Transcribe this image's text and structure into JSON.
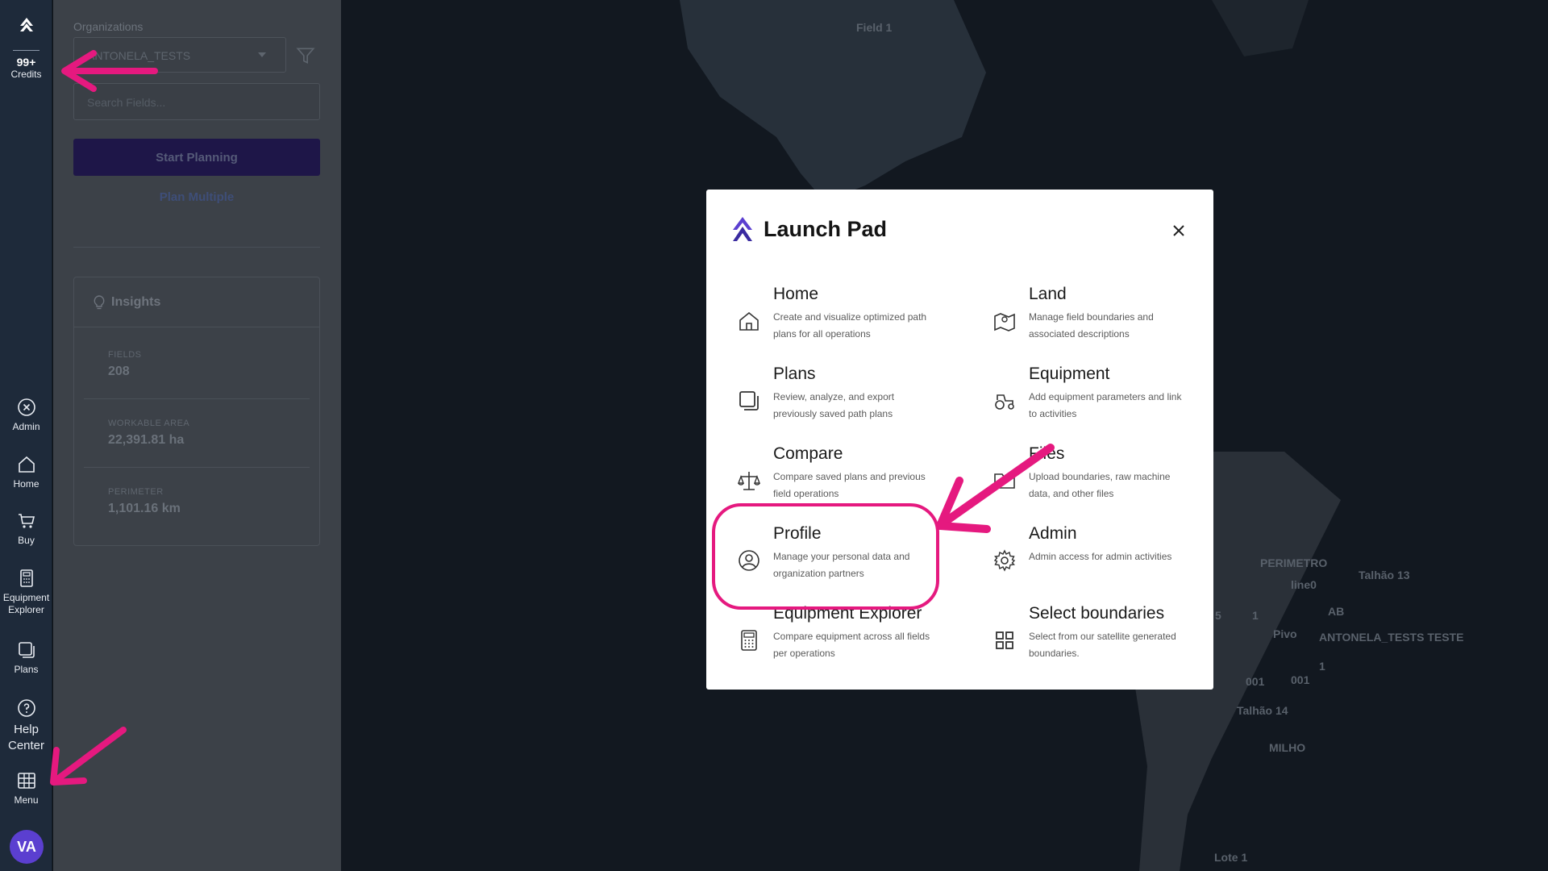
{
  "rail": {
    "credits_count": "99+",
    "credits_label": "Credits",
    "items": [
      {
        "label": "Admin"
      },
      {
        "label": "Home"
      },
      {
        "label": "Buy"
      },
      {
        "label": "Equipment Explorer"
      },
      {
        "label": "Plans"
      },
      {
        "label": "Help Center"
      },
      {
        "label": "Menu"
      }
    ],
    "avatar_initials": "VA"
  },
  "panel": {
    "org_label": "Organizations",
    "org_value": "ANTONELA_TESTS",
    "search_placeholder": "Search Fields...",
    "start_planning": "Start Planning",
    "plan_multiple": "Plan Multiple",
    "insights_title": "Insights",
    "stats": [
      {
        "label": "FIELDS",
        "value": "208"
      },
      {
        "label": "WORKABLE AREA",
        "value": "22,391.81 ha"
      },
      {
        "label": "PERIMETER",
        "value": "1,101.16 km"
      }
    ]
  },
  "map": {
    "labels": [
      "Field 1",
      "PERIMETRO",
      "Talhão 13",
      "line0",
      "AB",
      "Pivo",
      "ANTONELA_TESTS TESTE",
      "5",
      "1",
      "1",
      "001",
      "001",
      "Talhão 14",
      "MILHO",
      "Lote 1"
    ]
  },
  "modal": {
    "title": "Launch Pad",
    "tiles": [
      {
        "name": "Home",
        "desc": "Create and visualize optimized path plans for all operations",
        "icon": "home-icon"
      },
      {
        "name": "Land",
        "desc": "Manage field boundaries and associated descriptions",
        "icon": "map-icon"
      },
      {
        "name": "Plans",
        "desc": "Review, analyze, and export previously saved path plans",
        "icon": "plans-icon"
      },
      {
        "name": "Equipment",
        "desc": "Add equipment parameters and link to activities",
        "icon": "tractor-icon"
      },
      {
        "name": "Compare",
        "desc": "Compare saved plans and previous field operations",
        "icon": "scale-icon"
      },
      {
        "name": "Files",
        "desc": "Upload boundaries, raw machine data, and other files",
        "icon": "folder-icon"
      },
      {
        "name": "Profile",
        "desc": "Manage your personal data and organization partners",
        "icon": "user-circle-icon"
      },
      {
        "name": "Admin",
        "desc": "Admin access for admin activities",
        "icon": "gear-icon"
      },
      {
        "name": "Equipment Explorer",
        "desc": "Compare equipment across all fields per operations",
        "icon": "calculator-icon"
      },
      {
        "name": "Select boundaries",
        "desc": "Select from our satellite generated boundaries.",
        "icon": "grid-icon"
      }
    ]
  },
  "colors": {
    "rail_bg": "#1e2a3a",
    "brand_purple": "#5b3fd0",
    "annotation_pink": "#e5197f"
  }
}
